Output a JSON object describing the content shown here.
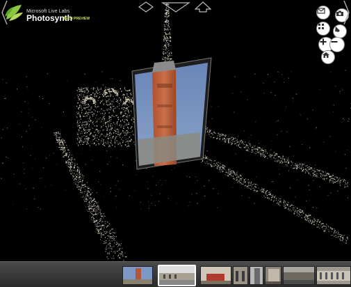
{
  "app": {
    "brand_small": "Microsoft Live Labs",
    "brand_name": "Photosynth",
    "brand_tag": "TECH PREVIEW"
  },
  "controls": [
    {
      "name": "mail-icon"
    },
    {
      "name": "camera-icon"
    },
    {
      "name": "grid-view-icon"
    },
    {
      "name": "feedback-icon"
    },
    {
      "name": "zoom-in-icon"
    },
    {
      "name": "zoom-out-icon"
    },
    {
      "name": "home-icon"
    }
  ],
  "colors": {
    "background": "#000000",
    "accent": "#c8e05a",
    "strip": "#3a3a3a"
  },
  "thumbnails": [
    {
      "name": "thumb-campanile",
      "selected": false
    },
    {
      "name": "thumb-piazza-wide",
      "selected": true
    },
    {
      "name": "thumb-basilica-facade",
      "selected": false
    },
    {
      "name": "thumb-arcade",
      "selected": false
    },
    {
      "name": "thumb-tower-close",
      "selected": false
    },
    {
      "name": "thumb-procuratie",
      "selected": false
    },
    {
      "name": "thumb-square-people",
      "selected": false
    }
  ]
}
